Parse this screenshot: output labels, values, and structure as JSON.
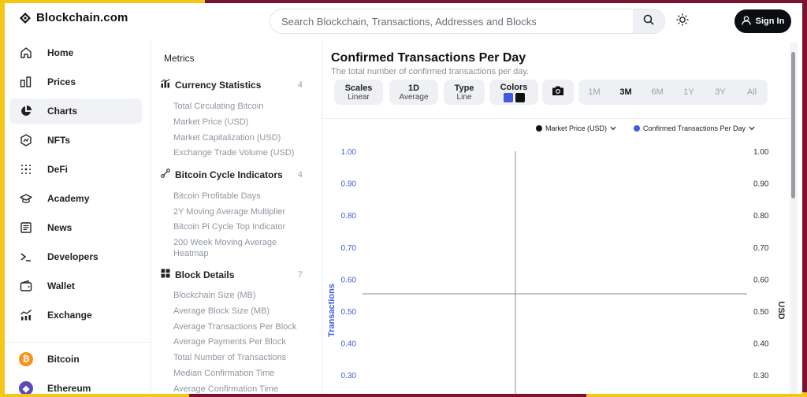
{
  "header": {
    "brand": "Blockchain.com",
    "search_placeholder": "Search Blockchain, Transactions, Addresses and Blocks",
    "signin_label": "Sign In"
  },
  "sidebar": {
    "items": [
      {
        "label": "Home",
        "icon": "home-icon"
      },
      {
        "label": "Prices",
        "icon": "bar-chart-icon"
      },
      {
        "label": "Charts",
        "icon": "pie-chart-icon"
      },
      {
        "label": "NFTs",
        "icon": "nft-icon"
      },
      {
        "label": "DeFi",
        "icon": "defi-dots-icon"
      },
      {
        "label": "Academy",
        "icon": "graduation-cap-icon"
      },
      {
        "label": "News",
        "icon": "newspaper-icon"
      },
      {
        "label": "Developers",
        "icon": "terminal-icon"
      },
      {
        "label": "Wallet",
        "icon": "wallet-icon"
      },
      {
        "label": "Exchange",
        "icon": "exchange-chart-icon"
      }
    ],
    "coins": [
      {
        "label": "Bitcoin",
        "icon": "bitcoin-icon",
        "color": "#f7931a",
        "symbol": "₿"
      },
      {
        "label": "Ethereum",
        "icon": "ethereum-icon",
        "color": "#5b4ab8",
        "symbol": "◆"
      }
    ],
    "active": "Charts"
  },
  "metrics": {
    "title": "Metrics",
    "groups": [
      {
        "title": "Currency Statistics",
        "count": "4",
        "items": [
          "Total Circulating Bitcoin",
          "Market Price (USD)",
          "Market Capitalization (USD)",
          "Exchange Trade Volume (USD)"
        ]
      },
      {
        "title": "Bitcoin Cycle Indicators",
        "count": "4",
        "items": [
          "Bitcoin Profitable Days",
          "2Y Moving Average Multiplier",
          "Bitcoin Pi Cycle Top Indicator",
          "200 Week Moving Average Heatmap"
        ]
      },
      {
        "title": "Block Details",
        "count": "7",
        "items": [
          "Blockchain Size (MB)",
          "Average Block Size (MB)",
          "Average Transactions Per Block",
          "Average Payments Per Block",
          "Total Number of Transactions",
          "Median Confirmation Time",
          "Average Confirmation Time"
        ]
      }
    ]
  },
  "chart": {
    "title": "Confirmed Transactions Per Day",
    "subtitle": "The total number of confirmed transactions per day.",
    "controls": {
      "scales": {
        "label": "Scales",
        "value": "Linear"
      },
      "interval": {
        "label": "1D",
        "value": "Average"
      },
      "type": {
        "label": "Type",
        "value": "Line"
      },
      "colors": {
        "label": "Colors",
        "swatches": [
          "#3f5be0",
          "#111111"
        ]
      }
    },
    "ranges": [
      "1M",
      "3M",
      "6M",
      "1Y",
      "3Y",
      "All"
    ],
    "active_range": "3M",
    "legend": [
      {
        "label": "Market Price (USD)",
        "color": "#111111"
      },
      {
        "label": "Confirmed Transactions Per Day",
        "color": "#3f5be0"
      }
    ]
  },
  "chart_data": {
    "type": "line",
    "title": "Confirmed Transactions Per Day",
    "ylabel_left": "Transactions",
    "ylabel_right": "USD",
    "ylim": [
      0.3,
      1.0
    ],
    "yticks": [
      "1.00",
      "0.90",
      "0.80",
      "0.70",
      "0.60",
      "0.50",
      "0.40",
      "0.30"
    ],
    "series": [
      {
        "name": "Market Price (USD)",
        "values": []
      },
      {
        "name": "Confirmed Transactions Per Day",
        "values": []
      }
    ],
    "colors": {
      "left_axis": "#3f5be0",
      "right_axis": "#333333"
    }
  }
}
